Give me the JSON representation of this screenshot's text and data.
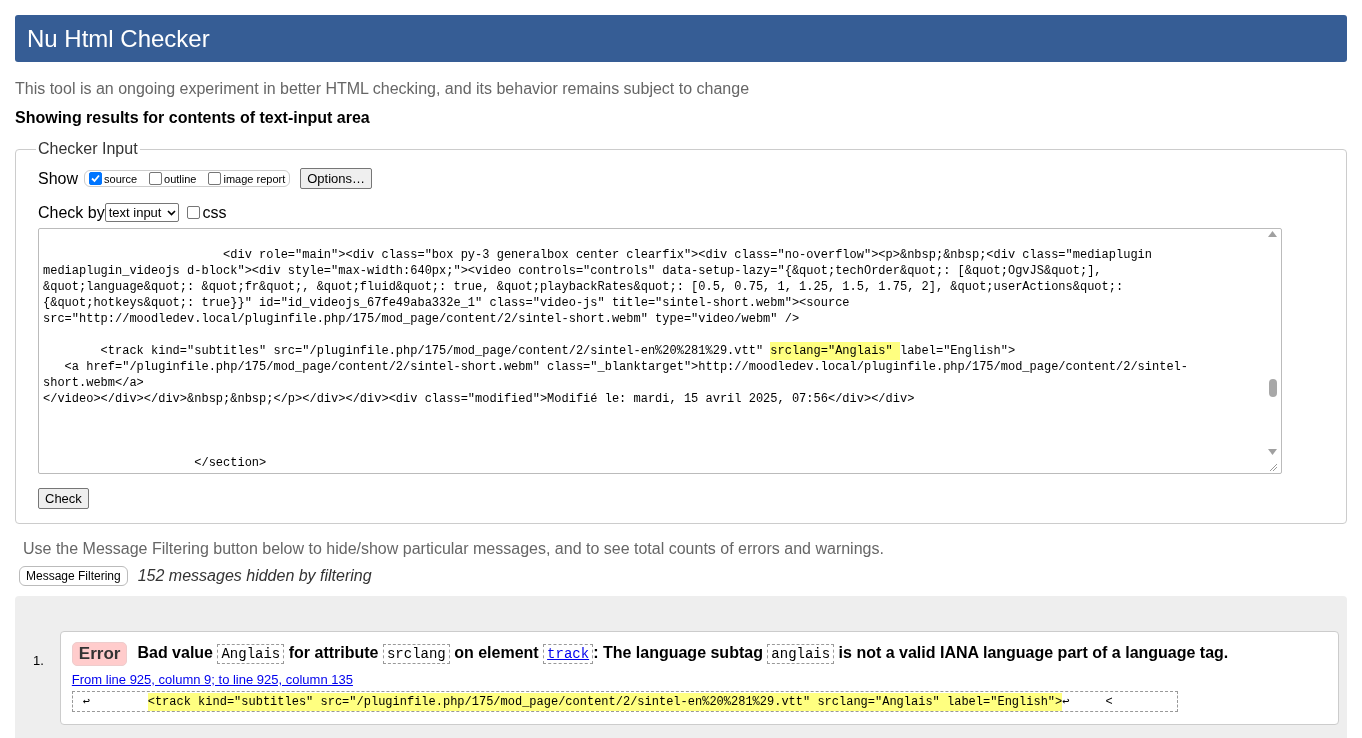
{
  "header": {
    "title": "Nu Html Checker"
  },
  "intro": "This tool is an ongoing experiment in better HTML checking, and its behavior remains subject to change",
  "results_heading": "Showing results for contents of text-input area",
  "checker_input": {
    "legend": "Checker Input",
    "show_label": "Show",
    "show_options": [
      {
        "label": "source",
        "checked": true
      },
      {
        "label": "outline",
        "checked": false
      },
      {
        "label": "image report",
        "checked": false
      }
    ],
    "options_button": "Options…",
    "check_by_label": "Check by",
    "check_by_value": "text input",
    "css": {
      "label": "css",
      "checked": false
    },
    "source_lines": [
      {
        "kind": "code",
        "text": "                         <div role=\"main\"><div class=\"box py-3 generalbox center clearfix\"><div class=\"no-overflow\"><p>&nbsp;&nbsp;<div class=\"mediaplugin"
      },
      {
        "kind": "code",
        "text": "mediaplugin_videojs d-block\"><div style=\"max-width:640px;\"><video controls=\"controls\" data-setup-lazy=\"{&quot;techOrder&quot;: [&quot;OgvJS&quot;],"
      },
      {
        "kind": "code",
        "text": "&quot;language&quot;: &quot;fr&quot;, &quot;fluid&quot;: true, &quot;playbackRates&quot;: [0.5, 0.75, 1, 1.25, 1.5, 1.75, 2], &quot;userActions&quot;:"
      },
      {
        "kind": "code",
        "text": "{&quot;hotkeys&quot;: true}}\" id=\"id_videojs_67fe49aba332e_1\" class=\"video-js\" title=\"sintel-short.webm\"><source"
      },
      {
        "kind": "code",
        "text": "src=\"http://moodledev.local/pluginfile.php/175/mod_page/content/2/sintel-short.webm\" type=\"video/webm\" />"
      },
      {
        "kind": "blank"
      },
      {
        "kind": "code",
        "text": "        <track kind=\"subtitles\" src=\"/pluginfile.php/175/mod_page/content/2/sintel-en%20%281%29.vtt\" ",
        "highlight": "srclang=\"Anglais\" ",
        "after": "label=\"English\">"
      },
      {
        "kind": "code",
        "text": "   <a href=\"/pluginfile.php/175/mod_page/content/2/sintel-short.webm\" class=\"_blanktarget\">http://moodledev.local/pluginfile.php/175/mod_page/content/2/sintel-"
      },
      {
        "kind": "code",
        "text": "short.webm</a>"
      },
      {
        "kind": "code",
        "text": "</video></div></div>&nbsp;&nbsp;</p></div></div><div class=\"modified\">Modifié le: mardi, 15 avril 2025, 07:56</div></div>"
      },
      {
        "kind": "blank"
      },
      {
        "kind": "blank"
      },
      {
        "kind": "blank"
      },
      {
        "kind": "code",
        "text": "                     </section>"
      }
    ],
    "check_button": "Check"
  },
  "filter_hint": "Use the Message Filtering button below to hide/show particular messages, and to see total counts of errors and warnings.",
  "filter_button": "Message Filtering",
  "hidden_count": "152 messages hidden by filtering",
  "messages": [
    {
      "number": "1.",
      "type": "Error",
      "parts": [
        {
          "kind": "text",
          "text": "Bad value "
        },
        {
          "kind": "code",
          "text": "Anglais"
        },
        {
          "kind": "text",
          "text": " for attribute "
        },
        {
          "kind": "code",
          "text": "srclang"
        },
        {
          "kind": "text",
          "text": " on element "
        },
        {
          "kind": "link",
          "text": "track"
        },
        {
          "kind": "text",
          "text": ": The language subtag "
        },
        {
          "kind": "code",
          "text": "anglais"
        },
        {
          "kind": "text",
          "text": " is not a valid IANA language part of a language tag."
        }
      ],
      "location": "From line 925, column 9; to line 925, column 135",
      "extract": {
        "before": "↩        ",
        "highlight": "<track kind=\"subtitles\" src=\"/pluginfile.php/175/mod_page/content/2/sintel-en%20%281%29.vtt\" srclang=\"Anglais\" label=\"English\">",
        "after": "↩     <"
      }
    }
  ]
}
